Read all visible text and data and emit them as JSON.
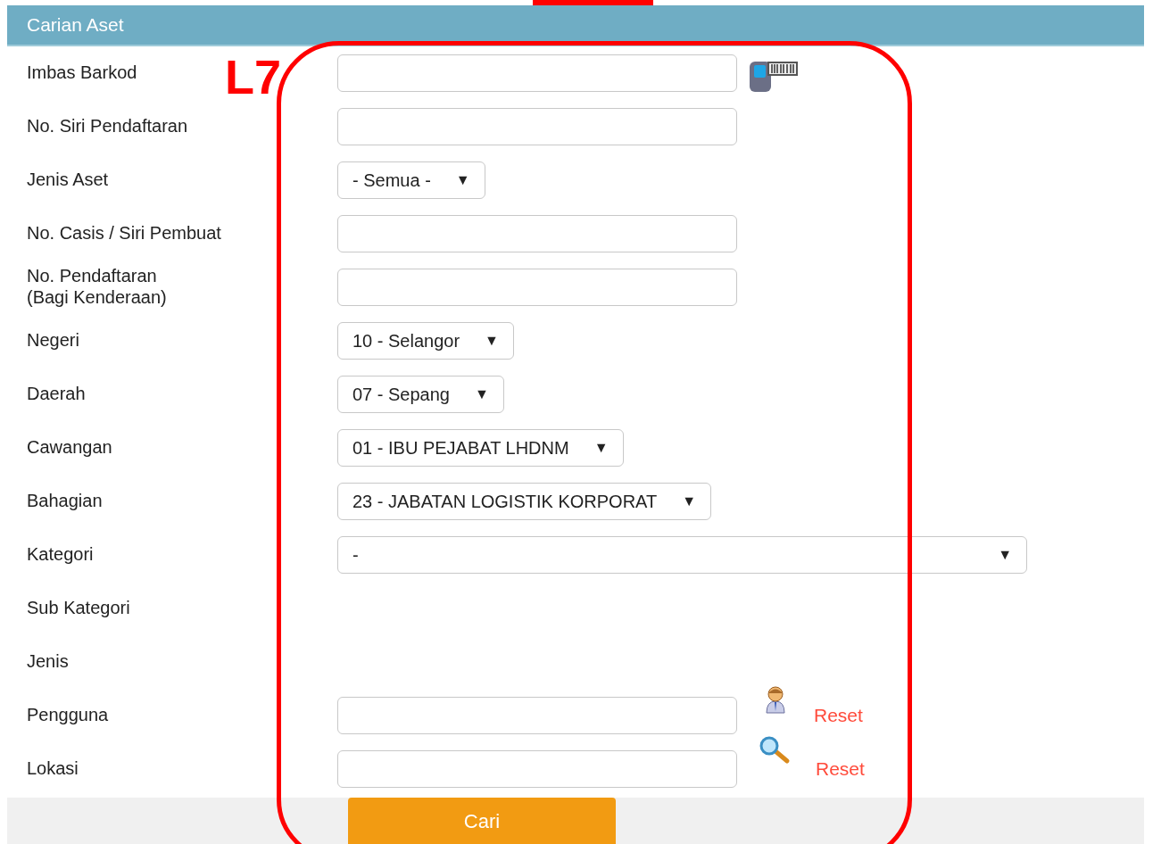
{
  "panel": {
    "title": "Carian Aset"
  },
  "annotation": {
    "label": "L7"
  },
  "fields": [
    {
      "label": "Imbas Barkod",
      "kind": "barcode_input"
    },
    {
      "label": "No. Siri Pendaftaran",
      "kind": "input"
    },
    {
      "label": "Jenis Aset",
      "kind": "select",
      "value": "- Semua -",
      "arrow": "▼"
    },
    {
      "label": "No. Casis / Siri Pembuat",
      "kind": "input"
    },
    {
      "label": "No. Pendaftaran\n(Bagi Kenderaan)",
      "kind": "input"
    },
    {
      "label": "Negeri",
      "kind": "select",
      "value": "10 - Selangor",
      "arrow": "▼"
    },
    {
      "label": "Daerah",
      "kind": "select",
      "value": "07 - Sepang",
      "arrow": "▼"
    },
    {
      "label": "Cawangan",
      "kind": "select",
      "value": "01 - IBU PEJABAT LHDNM",
      "arrow": "▼"
    },
    {
      "label": "Bahagian",
      "kind": "select",
      "value": "23 - JABATAN LOGISTIK KORPORAT",
      "arrow": "▼"
    },
    {
      "label": "Kategori",
      "kind": "wide_select",
      "value": "-",
      "arrow": "▼"
    },
    {
      "label": "Sub Kategori",
      "kind": "empty"
    },
    {
      "label": "Jenis",
      "kind": "empty"
    },
    {
      "label": "Pengguna",
      "kind": "user_input",
      "reset": "Reset"
    },
    {
      "label": "Lokasi",
      "kind": "location_input",
      "reset": "Reset"
    }
  ],
  "submit": "Cari"
}
